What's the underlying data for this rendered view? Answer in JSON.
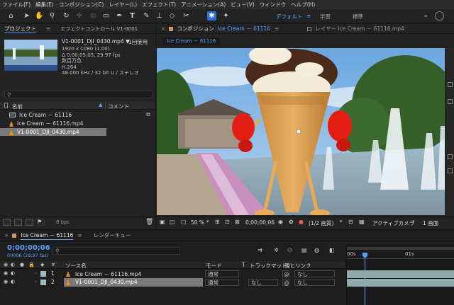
{
  "menu": [
    "ファイル(F)",
    "編集(E)",
    "コンポジション(C)",
    "レイヤー(L)",
    "エフェクト(T)",
    "アニメーション(A)",
    "ビュー(V)",
    "ウィンドウ",
    "ヘルプ(H)"
  ],
  "workspaces": {
    "default": "デフォルト",
    "learn": "学習",
    "standard": "標準"
  },
  "project_panel": {
    "tab_project": "プロジェクト",
    "tab_effects": "エフェクトコントロール V1-0001",
    "selected_name": "V1-0001_DJI_0430.mp4 ▼",
    "usage": "1回使用",
    "info": [
      "1920 x 1080 (1.00)",
      "Δ 0;00;05;05, 29.97 fps",
      "数百万色",
      "H.264",
      "48.000 kHz / 32 bit U / ステレオ"
    ],
    "search_placeholder": "",
    "col_name": "名前",
    "col_comment": "コメント",
    "items": [
      "Ice Cream － 61116",
      "Ice Cream － 61116.mp4",
      "V1-0001_DJI_0430.mp4"
    ],
    "bpc": "8 bpc"
  },
  "composition_panel": {
    "tab_label": "コンポジション",
    "tab_comp": "Ice Cream － 61116",
    "tab_layer": "レイヤー Ice Cream － 61116.mp4",
    "comp_chip": "Ice Cream － 61116",
    "zoom": "50 %",
    "timecode": "0;00;00;06",
    "resolution": "(1/2 画質)",
    "camera": "アクティブカメラ",
    "views": "1 画面"
  },
  "timeline": {
    "tab_comp": "Ice Cream － 61116",
    "tab_render": "レンダーキュー",
    "timecode": "0;00;00;06",
    "frame_info": "00006 (29.97 fps)",
    "col_source": "ソース名",
    "col_mode": "モード",
    "col_t": "T",
    "col_track": "トラックマット",
    "col_parent": "親とリンク",
    "ruler_start": "00s",
    "ruler_1s": "01s",
    "layers": [
      {
        "num": "1",
        "name": "Ice Cream － 61116.mp4",
        "mode": "通常",
        "track": "",
        "parent": "なし"
      },
      {
        "num": "2",
        "name": "V1-0001_DJI_0430.mp4",
        "mode": "通常",
        "track": "なし",
        "parent": "なし"
      }
    ]
  },
  "colors": {
    "accent": "#2d6fd6",
    "timecode_blue": "#5aa2ff",
    "layer_bar": "#8eaaaa"
  }
}
